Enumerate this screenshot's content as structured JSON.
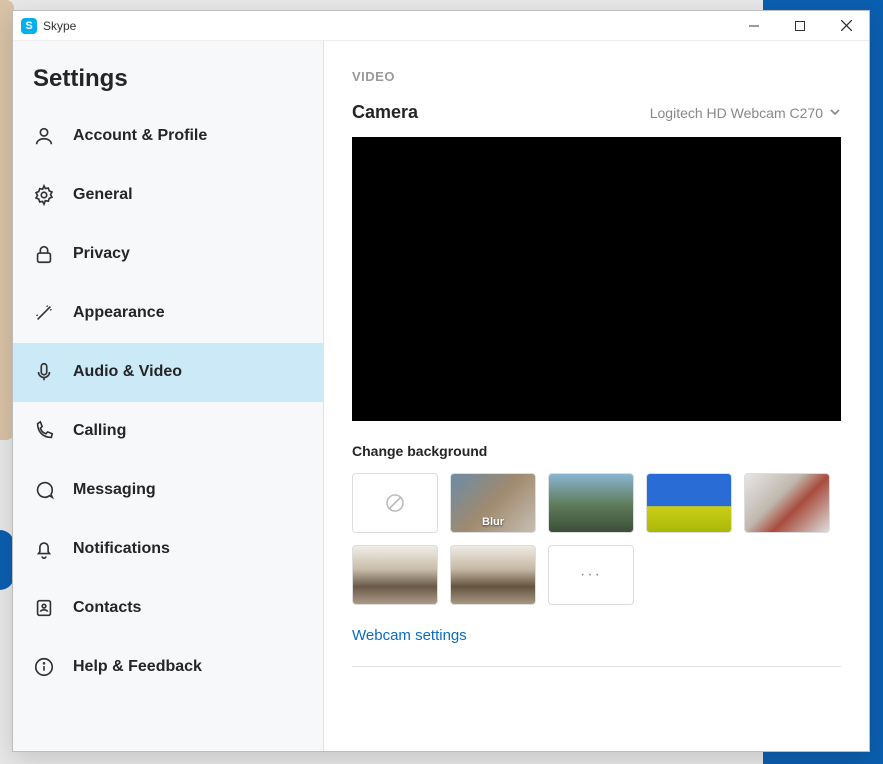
{
  "app": {
    "name": "Skype"
  },
  "settings_title": "Settings",
  "sidebar": {
    "items": [
      {
        "id": "account",
        "label": "Account & Profile",
        "icon": "user"
      },
      {
        "id": "general",
        "label": "General",
        "icon": "gear"
      },
      {
        "id": "privacy",
        "label": "Privacy",
        "icon": "lock"
      },
      {
        "id": "appearance",
        "label": "Appearance",
        "icon": "wand"
      },
      {
        "id": "audio-video",
        "label": "Audio & Video",
        "icon": "mic",
        "active": true
      },
      {
        "id": "calling",
        "label": "Calling",
        "icon": "phone"
      },
      {
        "id": "messaging",
        "label": "Messaging",
        "icon": "chat"
      },
      {
        "id": "notifications",
        "label": "Notifications",
        "icon": "bell"
      },
      {
        "id": "contacts",
        "label": "Contacts",
        "icon": "book"
      },
      {
        "id": "help",
        "label": "Help & Feedback",
        "icon": "info"
      }
    ]
  },
  "main": {
    "section_heading": "VIDEO",
    "camera_label": "Camera",
    "camera_selected": "Logitech HD Webcam C270",
    "change_bg_label": "Change background",
    "bg_options": {
      "blur_label": "Blur",
      "more_label": "···"
    },
    "webcam_settings_link": "Webcam settings"
  }
}
